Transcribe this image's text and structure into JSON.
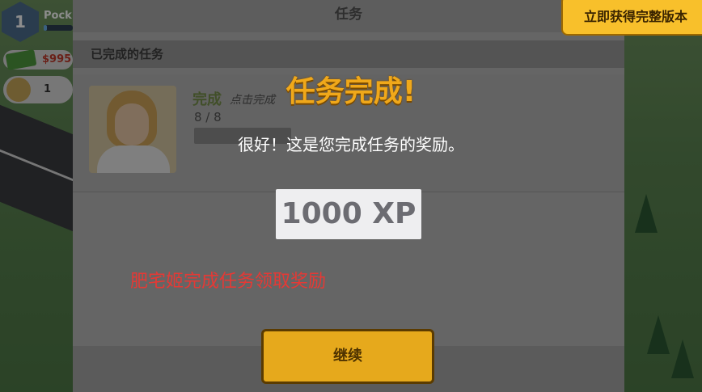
{
  "hud": {
    "level": "1",
    "player_name": "Pock",
    "xp_progress": 0.1,
    "money": "$995",
    "population": "1"
  },
  "panel": {
    "title": "任务",
    "section_title": "已完成的任务",
    "task": {
      "status": "完成",
      "hint": "点击完成",
      "progress": "8 / 8"
    }
  },
  "popup": {
    "title": "任务完成!",
    "message": "很好！这是您完成任务的奖励。",
    "reward": "1000 XP",
    "continue_label": "继续"
  },
  "caption": "肥宅姬完成任务领取奖励",
  "upgrade_label": "立即获得完整版本",
  "colors": {
    "title_orange": "#f0a81a",
    "button_yellow": "#e6a91c",
    "caption_red": "#e53935",
    "status_green": "#77904c"
  }
}
